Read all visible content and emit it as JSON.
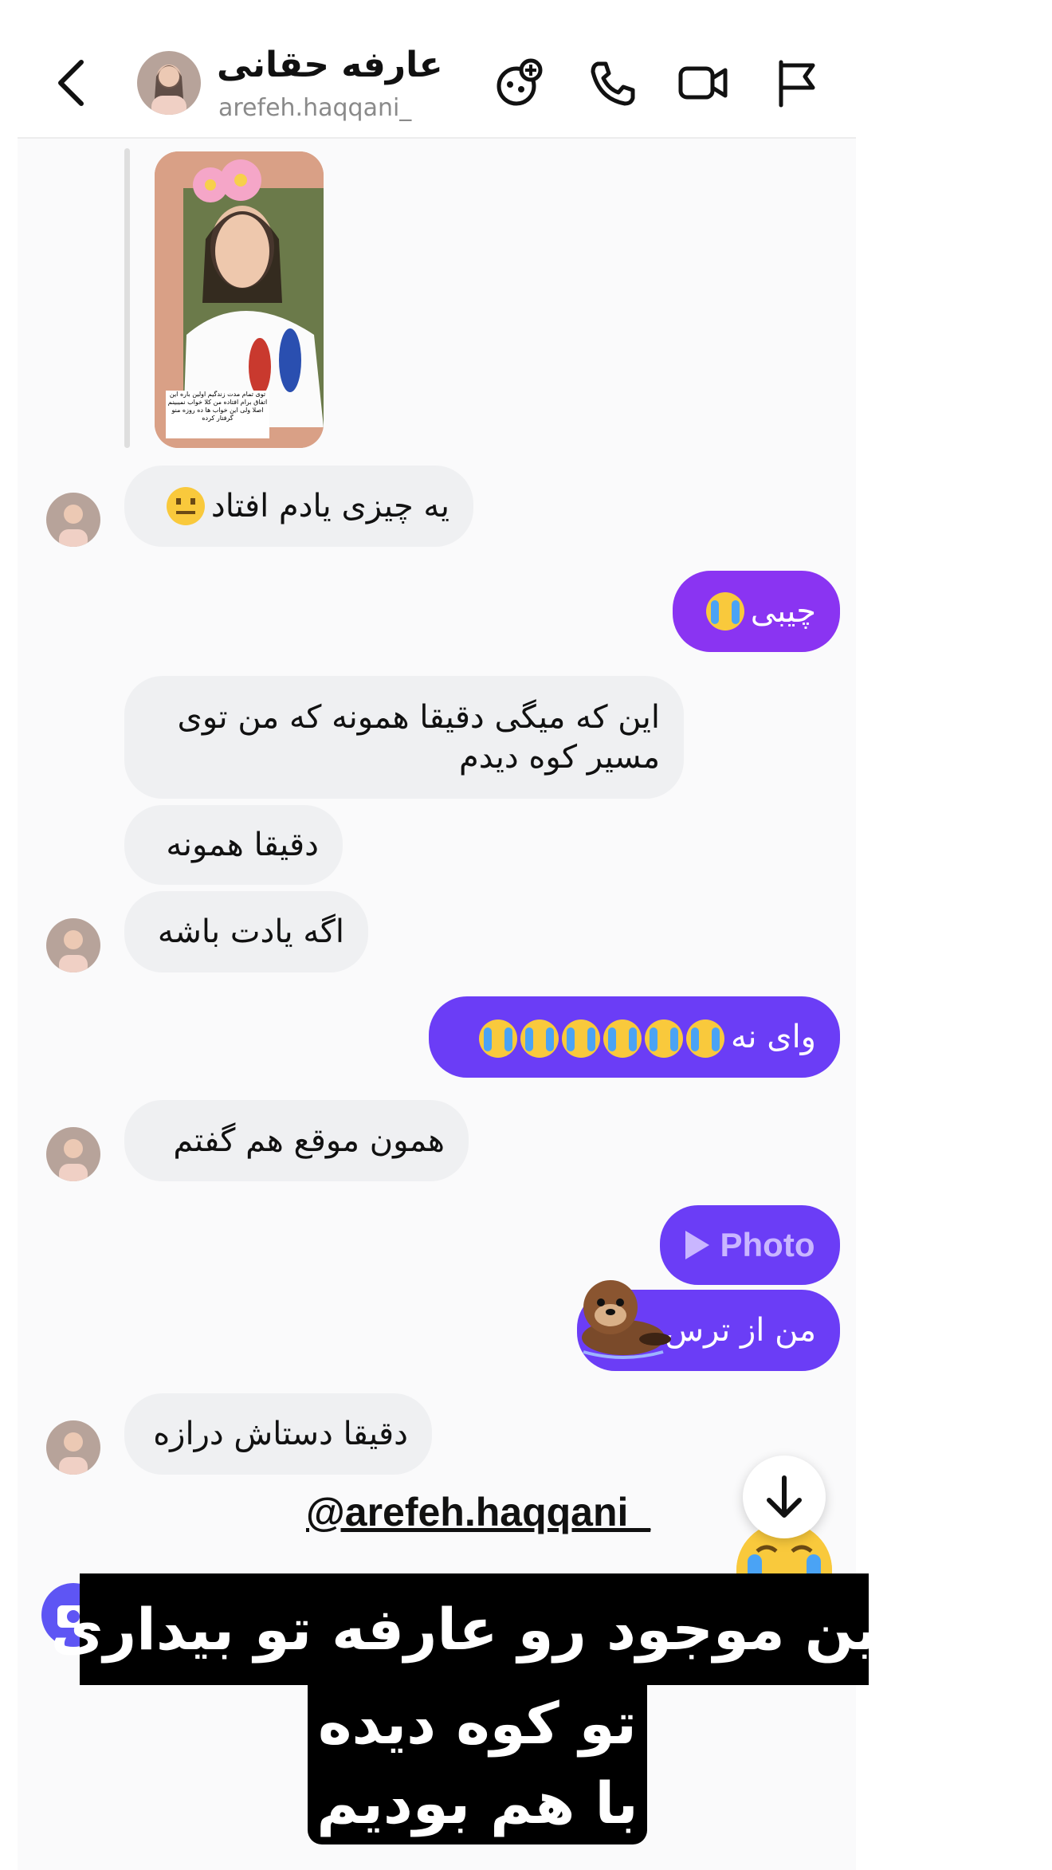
{
  "header": {
    "contact_name": "عارفه حقانی",
    "username": "arefeh.haqqani_",
    "icons": [
      "back-chevron-icon",
      "effects-icon",
      "phone-icon",
      "video-icon",
      "flag-icon"
    ]
  },
  "story_reply": {
    "caption": "توی تمام مدت زندگیم اولین باره این اتفاق برام افتاده من کلا خواب نمیبینم اصلا ولی این خواب ها ده روزه منو گرفتار کرده"
  },
  "messages": [
    {
      "side": "in",
      "text": "یه چیزی یادم افتاد",
      "emoji": "neutral-face-emoji"
    },
    {
      "side": "out",
      "text": "چیبی",
      "emoji": "crying-face-emoji"
    },
    {
      "side": "in",
      "line1": "این که میگی دقیقا همونه که من توی",
      "line2": "مسیر کوه دیدم"
    },
    {
      "side": "in",
      "text": "دقیقا همونه"
    },
    {
      "side": "in",
      "text": "اگه یادت باشه"
    },
    {
      "side": "out",
      "text": "وای نه",
      "emoji_count": 6
    },
    {
      "side": "in",
      "text": "همون موقع هم گفتم"
    },
    {
      "side": "out",
      "text": "Photo"
    },
    {
      "side": "out",
      "text": "من از ترس",
      "sticker": "otter-sticker"
    },
    {
      "side": "in",
      "text": "دقیقا دستاش درازه"
    }
  ],
  "overlay": {
    "mention": "@arefeh.haqqani_",
    "caption_line1": "این موجود رو عارفه تو بیداری",
    "caption_line2": "تو کوه دیده",
    "caption_line3": "با هم بودیم"
  },
  "colors": {
    "accent_purple": "#8a34f2",
    "accent_violet": "#6b3df6",
    "incoming_bubble": "#eff0f2"
  }
}
